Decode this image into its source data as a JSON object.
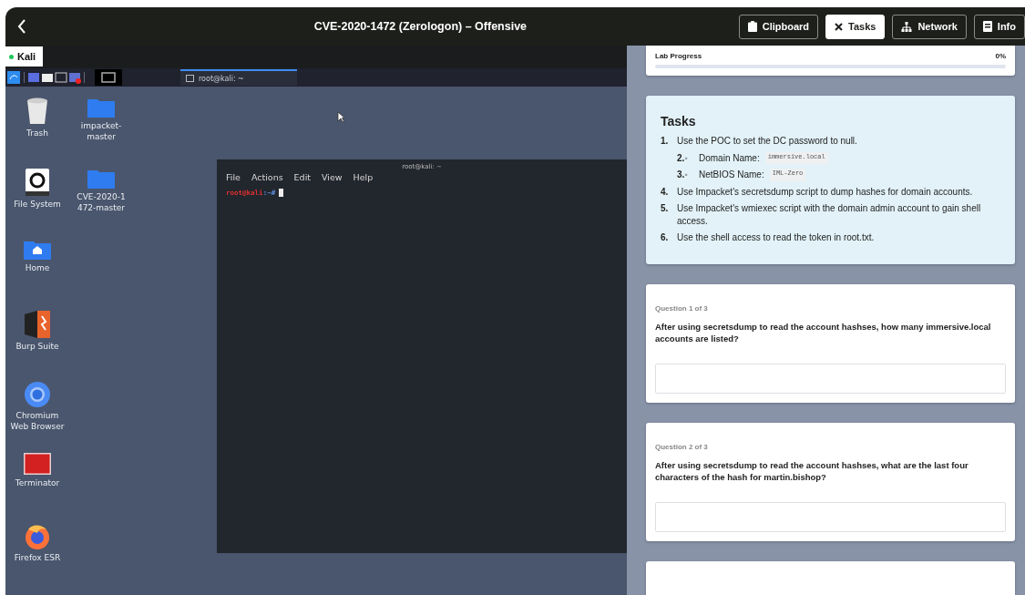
{
  "window": {
    "title": "CVE-2020-1472 (Zerologon) – Offensive"
  },
  "toolbar": [
    {
      "label": "Clipboard",
      "kind": "clipboard",
      "selected": false
    },
    {
      "label": "Tasks",
      "kind": "close",
      "selected": true
    },
    {
      "label": "Network",
      "kind": "network",
      "selected": false
    },
    {
      "label": "Info",
      "kind": "info",
      "selected": false
    }
  ],
  "vm": {
    "tab": {
      "label": "Kali",
      "online": true
    },
    "taskbar": {
      "window_tab": "root@kali: ~"
    },
    "desktop_columns": [
      [
        {
          "label": "Trash",
          "kind": "trash"
        },
        {
          "label": "File System",
          "kind": "drive"
        },
        {
          "label": "Home",
          "kind": "home"
        },
        {
          "label": "Burp Suite",
          "kind": "burp"
        },
        {
          "label": "Chromium\nWeb Browser",
          "kind": "chromium"
        },
        {
          "label": "Terminator",
          "kind": "terminator"
        },
        {
          "label": "Firefox ESR",
          "kind": "firefox"
        }
      ],
      [
        {
          "label": "impacket-\nmaster",
          "kind": "folder"
        },
        {
          "label": "CVE-2020-1\n472-master",
          "kind": "folder"
        }
      ]
    ],
    "terminal": {
      "title": "root@kali: ~",
      "menu": [
        "File",
        "Actions",
        "Edit",
        "View",
        "Help"
      ],
      "prompt_user": "root@kali",
      "prompt_path": ":~#"
    }
  },
  "panel": {
    "progress": {
      "label": "Lab Progress",
      "reading": "0%",
      "level": 0
    },
    "tasks": {
      "title": "Tasks",
      "items": [
        {
          "kind": "step",
          "number": "1.",
          "text": "Use the POC to set the DC password to null."
        },
        {
          "kind": "sub",
          "number": "2.◦",
          "label": "Domain Name:",
          "code": "immersive.local"
        },
        {
          "kind": "sub",
          "number": "3.◦",
          "label": "NetBIOS Name:",
          "code": "IML-Zero"
        },
        {
          "kind": "step",
          "number": "4.",
          "text": "Use Impacket's secretsdump script to dump hashes for domain accounts."
        },
        {
          "kind": "step",
          "number": "5.",
          "text": "Use Impacket's wmiexec script with the domain admin account to gain shell access."
        },
        {
          "kind": "step",
          "number": "6.",
          "text": "Use the shell access to read the token in root.txt."
        }
      ]
    },
    "questions": [
      {
        "label": "Question 1 of 3",
        "text": "After using secretsdump to read the account hashses, how many immersive.local accounts are listed?"
      },
      {
        "label": "Question 2 of 3",
        "text": "After using secretsdump to read the account hashses, what are the last four characters of the hash for martin.bishop?"
      }
    ]
  }
}
